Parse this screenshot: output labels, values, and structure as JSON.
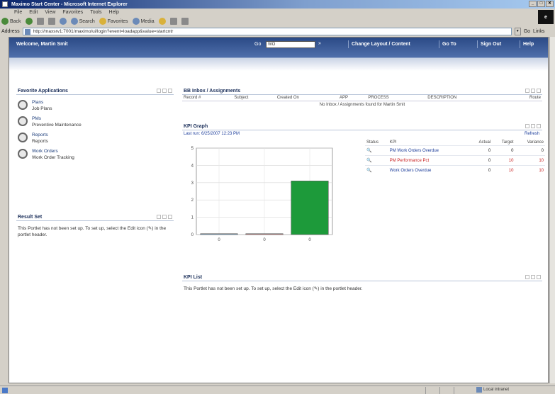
{
  "window": {
    "title": "Maximo Start Center - Microsoft Internet Explorer",
    "min": "_",
    "max": "□",
    "close": "✕"
  },
  "menu": [
    "File",
    "Edit",
    "View",
    "Favorites",
    "Tools",
    "Help"
  ],
  "toolbar": {
    "back": "Back",
    "search": "Search",
    "favorites": "Favorites",
    "media": "Media"
  },
  "address": {
    "label": "Address",
    "url": "http://maxsrv1:7001/maximo/ui/login?event=loadapp&value=startcntr",
    "go": "Go",
    "links": "Links"
  },
  "header": {
    "welcome": "Welcome, Martin Smit",
    "goto_label": "Go",
    "goto_value": "WO",
    "links": [
      "Change Layout / Content",
      "Go To",
      "Sign Out",
      "Help"
    ]
  },
  "favorites": {
    "title": "Favorite Applications",
    "items": [
      {
        "name": "Plans",
        "sub": "Job Plans",
        "icon": "gear-icon"
      },
      {
        "name": "PMs",
        "sub": "Preventive Maintenance",
        "icon": "wrench-icon"
      },
      {
        "name": "Reports",
        "sub": "Reports",
        "icon": "report-icon"
      },
      {
        "name": "Work Orders",
        "sub": "Work Order Tracking",
        "icon": "work-order-icon"
      }
    ]
  },
  "result_set": {
    "title": "Result Set",
    "text": "This Portlet has not been set up. To set up, select the Edit icon (✎) in the portlet header."
  },
  "inbox": {
    "title": "BB Inbox / Assignments",
    "columns": [
      "Record #",
      "Subject",
      "Created On",
      "APP",
      "PROCESS",
      "DESCRIPTION",
      "Route"
    ],
    "empty": "No Inbox / Assignments found for Martin Smit"
  },
  "kpi_graph": {
    "title": "KPI Graph",
    "last_run": "Last run: 6/25/2007 12:23 PM",
    "refresh": "Refresh",
    "columns": [
      "Status",
      "KPI",
      "Actual",
      "Target",
      "Variance"
    ],
    "rows": [
      {
        "kpi": "PM Work Orders Overdue",
        "actual": "0",
        "target": "0",
        "variance": "0",
        "red": false
      },
      {
        "kpi": "PM Performance Pct",
        "actual": "0",
        "target": "10",
        "variance": "10",
        "red": true
      },
      {
        "kpi": "Work Orders Overdue",
        "actual": "0",
        "target": "10",
        "variance": "10",
        "red": false
      }
    ]
  },
  "chart_data": {
    "type": "bar",
    "categories": [
      "0",
      "0",
      "0"
    ],
    "values": [
      0.05,
      0.05,
      3.1
    ],
    "ylim": [
      0,
      5
    ],
    "yticks": [
      "5",
      "4",
      "3",
      "2",
      "1",
      "0"
    ],
    "colors": [
      "#7fa7c7",
      "#c98080",
      "#1d9a3a"
    ]
  },
  "kpi_list": {
    "title": "KPI List",
    "text": "This Portlet has not been set up. To set up, select the Edit icon (✎) in the portlet header."
  },
  "status": {
    "zone": "Local intranet"
  }
}
